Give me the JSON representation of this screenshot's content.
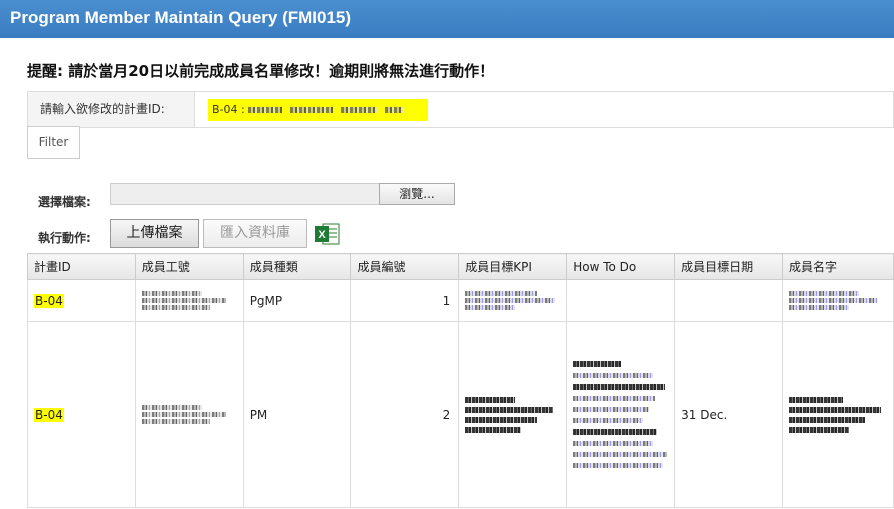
{
  "header": {
    "title": "Program Member Maintain Query (FMI015)"
  },
  "notice": "提醒: 請於當月20日以前完成成員名單修改！逾期則將無法進行動作！",
  "program_filter": {
    "label": "請輸入欲修改的計畫ID:",
    "value_prefix": "B-04 : "
  },
  "filter_button": "Filter",
  "upload": {
    "file_label": "選擇檔案:",
    "browse_label": "瀏覽...",
    "action_label": "執行動作:",
    "upload_button": "上傳檔案",
    "import_button": "匯入資料庫",
    "excel_icon": "excel-icon"
  },
  "table": {
    "columns": [
      "計畫ID",
      "成員工號",
      "成員種類",
      "成員編號",
      "成員目標KPI",
      "How To Do",
      "成員目標日期",
      "成員名字"
    ],
    "rows": [
      {
        "program_id": "B-04",
        "member_type": "PgMP",
        "member_no": "1",
        "target_date": ""
      },
      {
        "program_id": "B-04",
        "member_type": "PM",
        "member_no": "2",
        "target_date": "31 Dec."
      }
    ]
  },
  "colors": {
    "title_bar": "#3f83c6",
    "highlight": "#ffff00"
  }
}
